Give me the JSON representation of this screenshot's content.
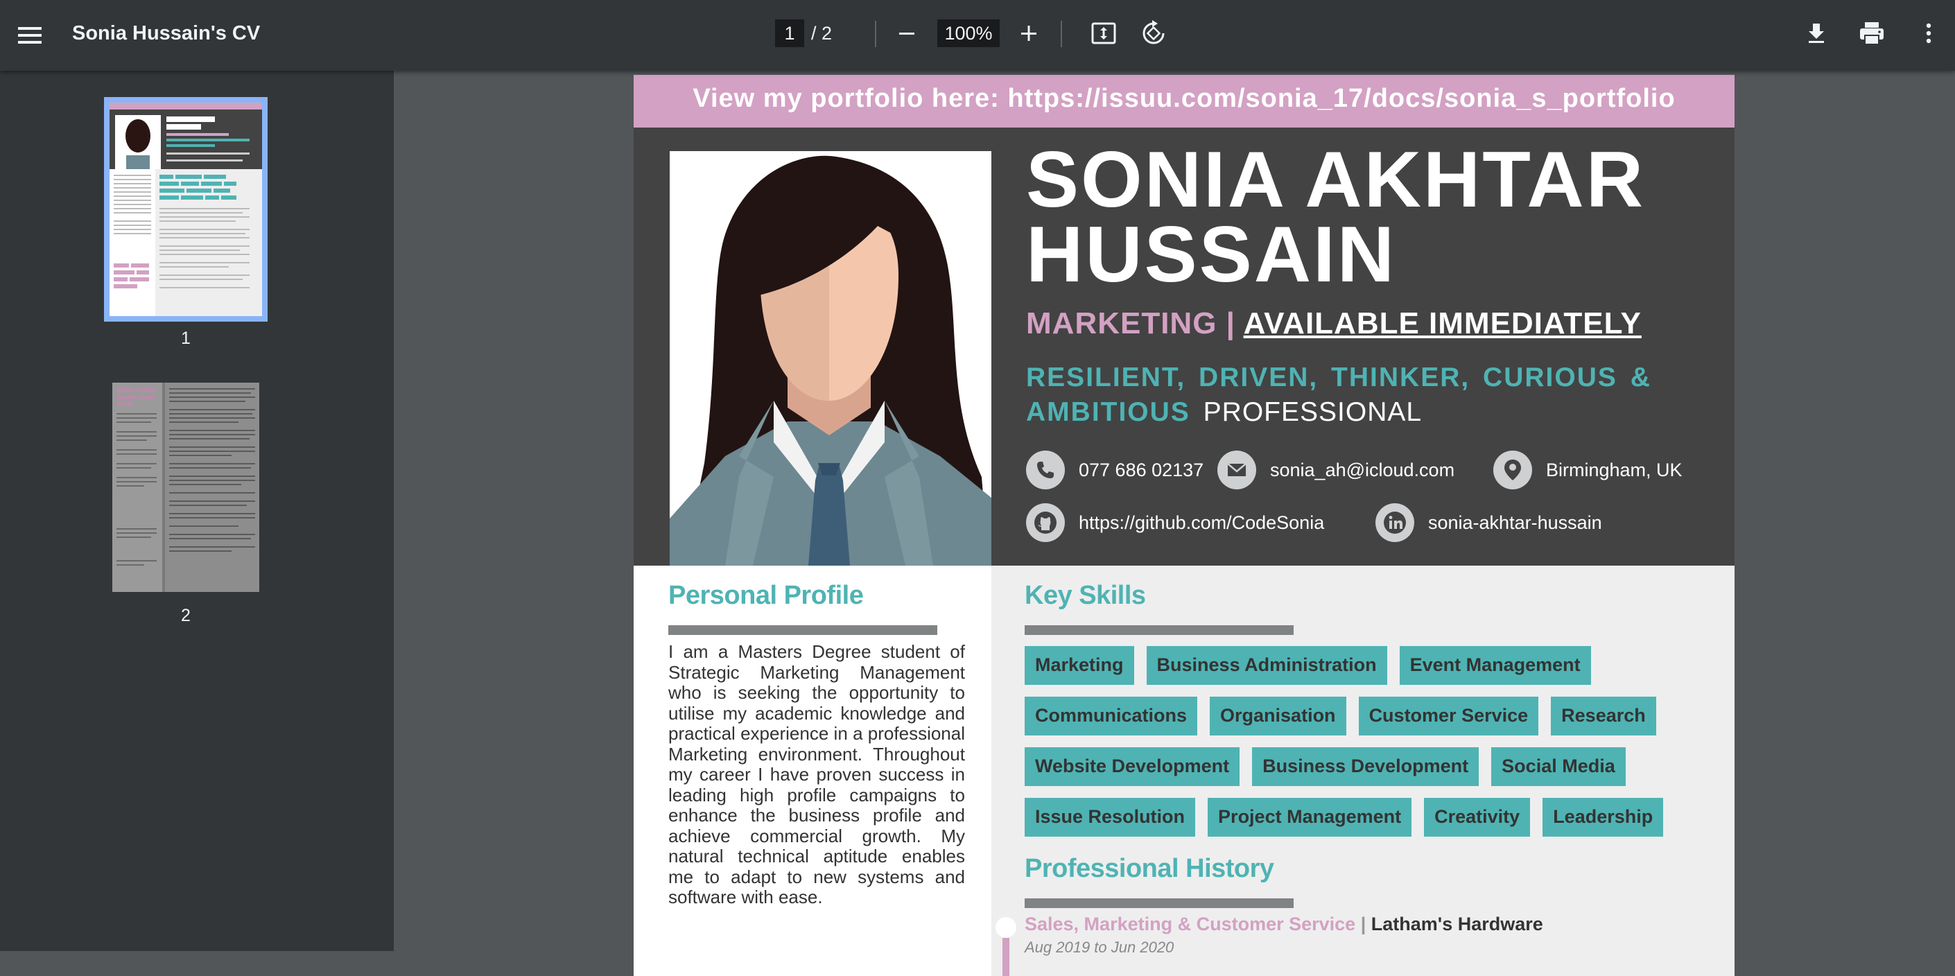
{
  "toolbar": {
    "title": "Sonia Hussain's CV",
    "current_page": "1",
    "page_total": "/  2",
    "zoom": "100%"
  },
  "sidebar": {
    "thumbnails": [
      {
        "label": "1",
        "selected": true
      },
      {
        "label": "2",
        "selected": false
      }
    ]
  },
  "cv": {
    "banner": "View my portfolio here: https://issuu.com/sonia_17/docs/sonia_s_portfolio",
    "name_line1": "SONIA AKHTAR",
    "name_line2": "HUSSAIN",
    "role": "MARKETING",
    "role_sep": " | ",
    "availability": "AVAILABLE IMMEDIATELY",
    "traits": "RESILIENT, DRIVEN, THINKER, CURIOUS & AMBITIOUS",
    "traits_suffix": "PROFESSIONAL",
    "contact": {
      "phone": "077 686 02137",
      "email": "sonia_ah@icloud.com",
      "location": "Birmingham, UK",
      "github": "https://github.com/CodeSonia",
      "linkedin": "sonia-akhtar-hussain"
    },
    "profile_title": "Personal Profile",
    "profile_text": "I am a Masters Degree student of Strategic Marketing Management who is seeking the opportunity to utilise my academic knowledge and practical experience in a professional Marketing environment. Throughout my career I have proven success in leading high profile campaigns to enhance the business profile and achieve commercial growth. My natural technical aptitude enables me to adapt to new systems and software with ease.",
    "skills_title": "Key Skills",
    "skills": [
      "Marketing",
      "Business Administration",
      "Event Management",
      "Communications",
      "Organisation",
      "Customer Service",
      "Research",
      "Website Development",
      "Business Development",
      "Social Media",
      "Issue Resolution",
      "Project Management",
      "Creativity",
      "Leadership"
    ],
    "history_title": "Professional History",
    "history": [
      {
        "role": "Sales, Marketing & Customer Service",
        "sep": " | ",
        "company": "Latham's Hardware",
        "dates": "Aug 2019 to Jun 2020"
      }
    ]
  },
  "colors": {
    "accent_teal": "#4fb3b3",
    "accent_pink": "#d3a1c3",
    "header_dark": "#434343",
    "viewer_bg": "#525659",
    "toolbar_bg": "#323639"
  },
  "icons": [
    "menu-icon",
    "minus-icon",
    "plus-icon",
    "fit-page-icon",
    "rotate-icon",
    "download-icon",
    "print-icon",
    "more-vert-icon",
    "phone-icon",
    "email-icon",
    "location-icon",
    "github-icon",
    "linkedin-icon"
  ]
}
